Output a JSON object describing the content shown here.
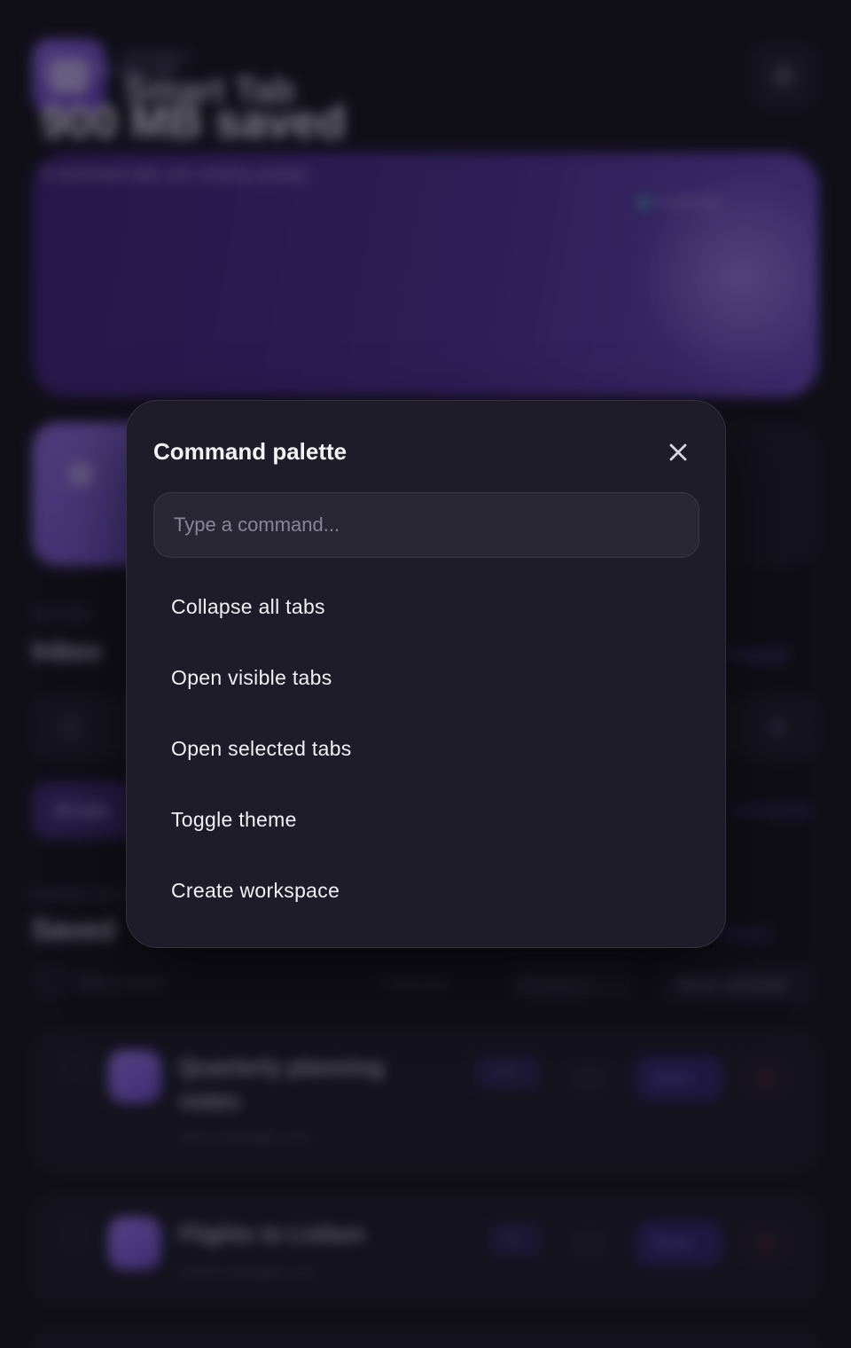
{
  "background": {
    "brand": {
      "kicker": "SHOBEY",
      "title": "Smart Tab",
      "settings_icon": "gear-icon"
    },
    "hero": {
      "kicker": "MEMORY RELIEF",
      "value": "900 MB saved",
      "subtitle": "6 archived tabs are resting quietly",
      "badge": "Local only"
    },
    "inbox": {
      "kicker": "ACTIVE",
      "title": "Inbox",
      "link": "Prepare"
    },
    "chips": {
      "all_label": "All tabs",
      "link": "Commands"
    },
    "saved": {
      "kicker": "FOCUS SESSIONS",
      "title": "Saved",
      "link": "Import",
      "select_label": "Select visible",
      "count_label": "0 selected",
      "sort_label": "Research",
      "move_label": "Move selected"
    },
    "cards": [
      {
        "title": "Quarterly planning notes",
        "domain": "docs.example.com",
        "tag": "work",
        "open_label": "Open"
      },
      {
        "title": "Flights to Lisbon",
        "domain": "travel.example.com",
        "tag": "trip",
        "open_label": "Open"
      }
    ]
  },
  "palette": {
    "title": "Command palette",
    "close_icon": "close-icon",
    "input": {
      "placeholder": "Type a command...",
      "value": ""
    },
    "commands": [
      {
        "label": "Collapse all tabs"
      },
      {
        "label": "Open visible tabs"
      },
      {
        "label": "Open selected tabs"
      },
      {
        "label": "Toggle theme"
      },
      {
        "label": "Create workspace"
      }
    ]
  },
  "colors": {
    "page_bg": "#15131d",
    "palette_bg": "#1e1c28",
    "accent": "#6d4dd0",
    "text": "#f1f0f6"
  }
}
